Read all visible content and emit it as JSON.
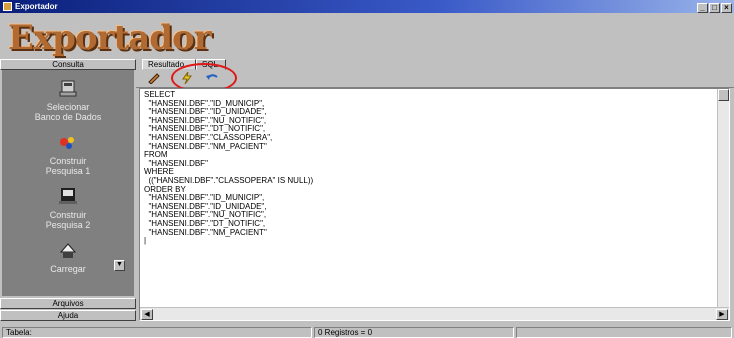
{
  "window": {
    "title": "Exportador",
    "controls": [
      "minimize",
      "maximize",
      "close"
    ]
  },
  "logo": {
    "text": "Exportador",
    "color": "#b06a32"
  },
  "sidebar": {
    "top_tab": "Consulta",
    "items": [
      {
        "icon": "database-select-icon",
        "label": "Selecionar\nBanco de Dados"
      },
      {
        "icon": "query-builder-icon",
        "label": "Construir\nPesquisa 1"
      },
      {
        "icon": "query-builder-2-icon",
        "label": "Construir\nPesquisa 2"
      },
      {
        "icon": "load-icon",
        "label": "Carregar"
      }
    ],
    "bottom_tabs": [
      "Arquivos",
      "Ajuda"
    ]
  },
  "tabs": [
    {
      "label": "Resultado",
      "active": true
    },
    {
      "label": "SQL",
      "active": false
    }
  ],
  "toolbar": {
    "buttons": [
      {
        "icon": "pencil-edit-icon"
      },
      {
        "icon": "lightning-execute-icon"
      },
      {
        "icon": "undo-arrow-icon"
      }
    ],
    "highlight_color": "#e01818"
  },
  "editor": {
    "sql_text": "SELECT\n  \"HANSENI.DBF\".\"ID_MUNICIP\",\n  \"HANSENI.DBF\".\"ID_UNIDADE\",\n  \"HANSENI.DBF\".\"NU_NOTIFIC\",\n  \"HANSENI.DBF\".\"DT_NOTIFIC\",\n  \"HANSENI.DBF\".\"CLASSOPERA\",\n  \"HANSENI.DBF\".\"NM_PACIENT\"\nFROM\n  \"HANSENI.DBF\"\nWHERE\n  ((\"HANSENI.DBF\".\"CLASSOPERA\" IS NULL))\nORDER BY\n  \"HANSENI.DBF\".\"ID_MUNICIP\",\n  \"HANSENI.DBF\".\"ID_UNIDADE\",\n  \"HANSENI.DBF\".\"NU_NOTIFIC\",\n  \"HANSENI.DBF\".\"DT_NOTIFIC\",\n  \"HANSENI.DBF\".\"NM_PACIENT\"\n|"
  },
  "statusbar": {
    "left": "Tabela:",
    "middle": "0 Registros = 0"
  }
}
